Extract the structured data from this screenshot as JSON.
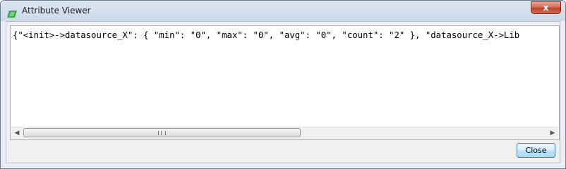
{
  "window": {
    "title": "Attribute Viewer",
    "close_glyph": "x"
  },
  "content": {
    "text": "{\"<init>->datasource_X\": { \"min\": \"0\", \"max\": \"0\", \"avg\": \"0\", \"count\": \"2\" }, \"datasource_X->Lib"
  },
  "scrollbar": {
    "left_arrow": "◀",
    "right_arrow": "▶"
  },
  "buttons": {
    "close_label": "Close"
  },
  "icons": {
    "app": "app-icon",
    "close": "close-icon"
  }
}
